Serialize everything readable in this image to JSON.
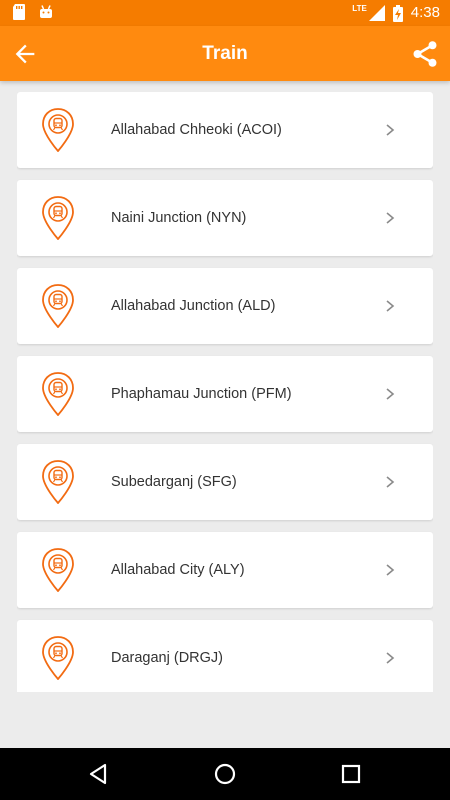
{
  "status_bar": {
    "time": "4:38",
    "network_label": "LTE",
    "icons": [
      "sd-card-icon",
      "android-icon",
      "signal-icon",
      "battery-charging-icon"
    ]
  },
  "app_bar": {
    "title": "Train",
    "back_icon": "back-arrow-icon",
    "share_icon": "share-icon"
  },
  "stations": [
    {
      "label": "Allahabad Chheoki (ACOI)"
    },
    {
      "label": "Naini Junction (NYN)"
    },
    {
      "label": "Allahabad Junction (ALD)"
    },
    {
      "label": "Phaphamau Junction (PFM)"
    },
    {
      "label": "Subedarganj (SFG)"
    },
    {
      "label": "Allahabad City (ALY)"
    },
    {
      "label": "Daraganj (DRGJ)"
    }
  ],
  "nav_bar": {
    "icons": [
      "back-triangle-icon",
      "home-circle-icon",
      "recents-square-icon"
    ]
  },
  "colors": {
    "status_bar": "#f57c00",
    "app_bar": "#ff8a0f",
    "accent": "#f26b12",
    "background": "#ececec"
  }
}
